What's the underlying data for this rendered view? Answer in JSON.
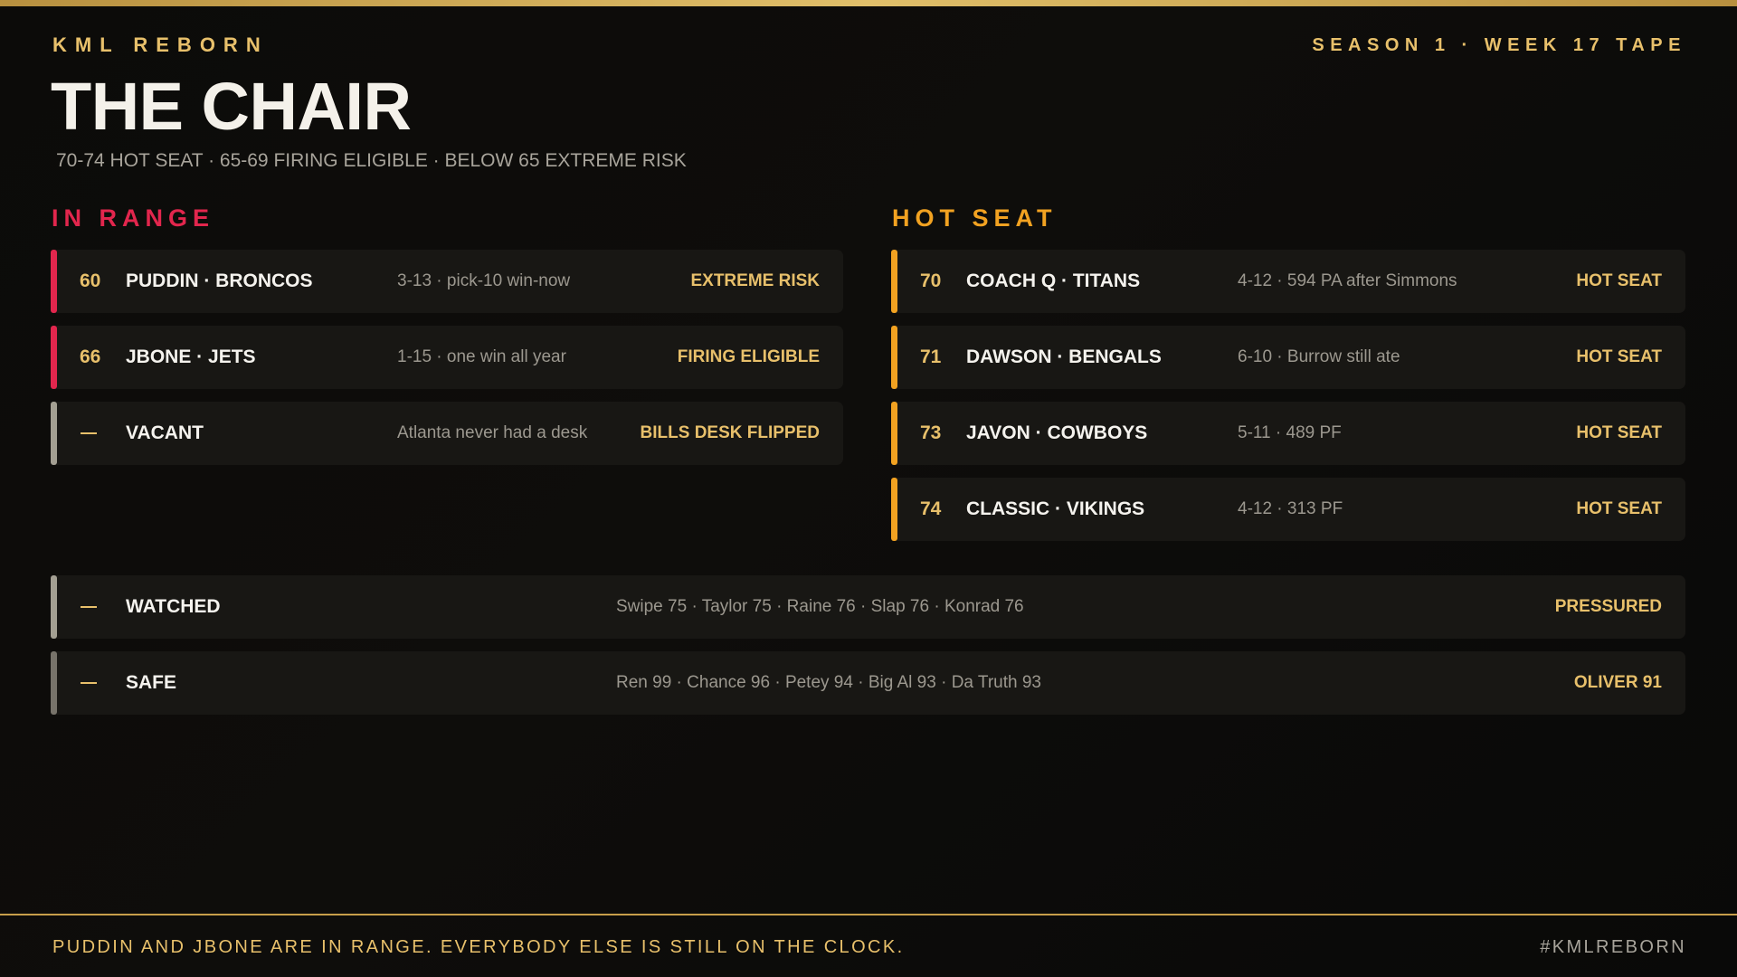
{
  "header": {
    "brand": "KML REBORN",
    "season_label": "SEASON 1 · WEEK 17 TAPE",
    "title": "THE CHAIR",
    "subtitle": "70-74 HOT SEAT · 65-69 FIRING ELIGIBLE · BELOW 65 EXTREME RISK"
  },
  "colors": {
    "gold": "#e8c06b",
    "range_red": "#e2264d",
    "hot_orange": "#f2a221",
    "vacant_gray": "#a39f92",
    "safe_gray": "#77736a"
  },
  "in_range": {
    "heading": "IN RANGE",
    "rows": [
      {
        "score": "60",
        "name": "PUDDIN · BRONCOS",
        "note": "3-13 · pick-10 win-now",
        "status": "EXTREME RISK"
      },
      {
        "score": "66",
        "name": "JBONE · JETS",
        "note": "1-15 · one win all year",
        "status": "FIRING ELIGIBLE"
      },
      {
        "score": "",
        "name": "VACANT",
        "note": "Atlanta never had a desk",
        "status": "BILLS DESK FLIPPED"
      }
    ]
  },
  "hot_seat": {
    "heading": "HOT SEAT",
    "rows": [
      {
        "score": "70",
        "name": "COACH Q · TITANS",
        "note": "4-12 · 594 PA after Simmons",
        "status": "HOT SEAT"
      },
      {
        "score": "71",
        "name": "DAWSON · BENGALS",
        "note": "6-10 · Burrow still ate",
        "status": "HOT SEAT"
      },
      {
        "score": "73",
        "name": "JAVON · COWBOYS",
        "note": "5-11 · 489 PF",
        "status": "HOT SEAT"
      },
      {
        "score": "74",
        "name": "CLASSIC · VIKINGS",
        "note": "4-12 · 313 PF",
        "status": "HOT SEAT"
      }
    ]
  },
  "tiers": [
    {
      "name": "WATCHED",
      "note": "Swipe 75 · Taylor 75 · Raine 76 · Slap 76 · Konrad 76",
      "status": "PRESSURED"
    },
    {
      "name": "SAFE",
      "note": "Ren 99 · Chance 96 · Petey 94 · Big Al 93 · Da Truth 93",
      "status": "OLIVER 91"
    }
  ],
  "footer": {
    "message": "PUDDIN AND JBONE ARE IN RANGE. EVERYBODY ELSE IS STILL ON THE CLOCK.",
    "hashtag": "#KMLREBORN"
  }
}
